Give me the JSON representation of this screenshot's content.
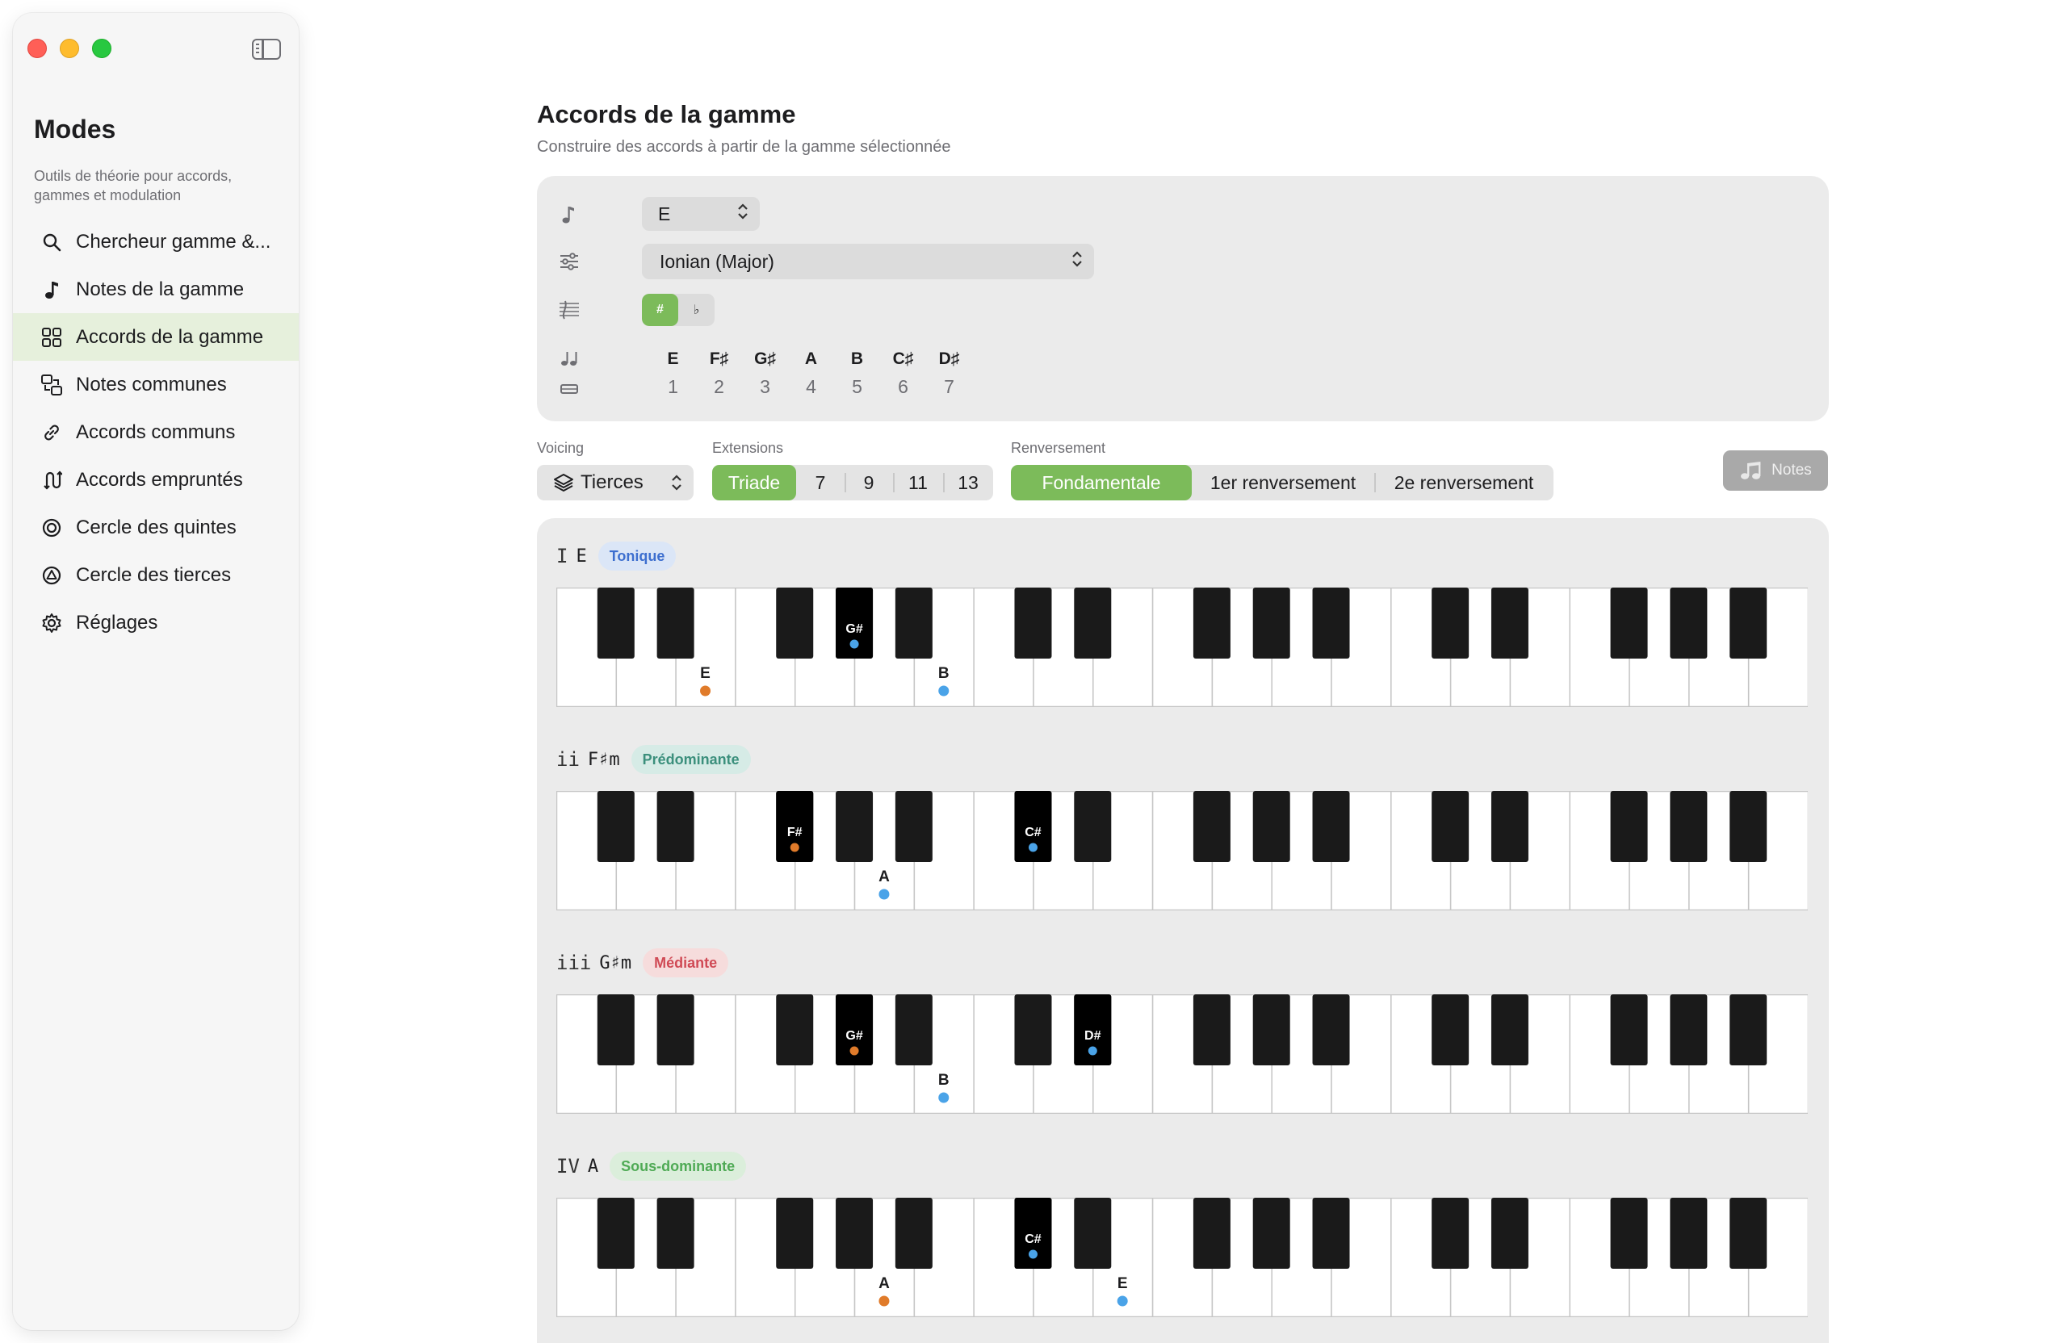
{
  "sidebar": {
    "title": "Modes",
    "description": "Outils de théorie pour accords, gammes et modulation",
    "items": [
      {
        "label": "Chercheur gamme &...",
        "icon": "search-icon",
        "active": false
      },
      {
        "label": "Notes de la gamme",
        "icon": "music-note-icon",
        "active": false
      },
      {
        "label": "Accords de la gamme",
        "icon": "grid-icon",
        "active": true
      },
      {
        "label": "Notes communes",
        "icon": "shared-notes-icon",
        "active": false
      },
      {
        "label": "Accords communs",
        "icon": "link-icon",
        "active": false
      },
      {
        "label": "Accords empruntés",
        "icon": "borrow-icon",
        "active": false
      },
      {
        "label": "Cercle des quintes",
        "icon": "circle-icon",
        "active": false
      },
      {
        "label": "Cercle des tierces",
        "icon": "triangle-circle-icon",
        "active": false
      },
      {
        "label": "Réglages",
        "icon": "gear-icon",
        "active": false
      }
    ]
  },
  "main": {
    "title": "Accords de la gamme",
    "subtitle": "Construire des accords à partir de la gamme sélectionnée"
  },
  "scale": {
    "root": "E",
    "mode": "Ionian (Major)",
    "sharp_label": "#",
    "flat_label": "♭",
    "notes": [
      "E",
      "F♯",
      "G♯",
      "A",
      "B",
      "C♯",
      "D♯"
    ],
    "degrees": [
      "1",
      "2",
      "3",
      "4",
      "5",
      "6",
      "7"
    ]
  },
  "controls": {
    "voicing_label": "Voicing",
    "voicing_value": "Tierces",
    "extensions_label": "Extensions",
    "extensions": [
      "Triade",
      "7",
      "9",
      "11",
      "13"
    ],
    "extensions_selected": "Triade",
    "inversion_label": "Renversement",
    "inversions": [
      "Fondamentale",
      "1er renversement",
      "2e renversement"
    ],
    "inversion_selected": "Fondamentale",
    "notes_button": "Notes"
  },
  "colors": {
    "accent": "#7cbb5a",
    "root_dot": "#e07b2a",
    "tone_dot": "#4aa3e8"
  },
  "chords": [
    {
      "roman": "I",
      "name": "E",
      "function": "Tonique",
      "badge_bg": "#dbe6f7",
      "badge_fg": "#3d6fcf",
      "notes": [
        {
          "label": "E",
          "kind": "white",
          "index": 2,
          "root": true
        },
        {
          "label": "G#",
          "kind": "black",
          "index": 3,
          "root": false
        },
        {
          "label": "B",
          "kind": "white",
          "index": 6,
          "root": false
        }
      ]
    },
    {
      "roman": "ii",
      "name": "F♯m",
      "function": "Prédominante",
      "badge_bg": "#d6ebe6",
      "badge_fg": "#3b8f7c",
      "notes": [
        {
          "label": "F#",
          "kind": "black",
          "index": 2,
          "root": true
        },
        {
          "label": "A",
          "kind": "white",
          "index": 5,
          "root": false
        },
        {
          "label": "C#",
          "kind": "black",
          "index": 5,
          "root": false
        }
      ]
    },
    {
      "roman": "iii",
      "name": "G♯m",
      "function": "Médiante",
      "badge_bg": "#f6dcdc",
      "badge_fg": "#d04a55",
      "notes": [
        {
          "label": "G#",
          "kind": "black",
          "index": 3,
          "root": true
        },
        {
          "label": "B",
          "kind": "white",
          "index": 6,
          "root": false
        },
        {
          "label": "D#",
          "kind": "black",
          "index": 6,
          "root": false
        }
      ]
    },
    {
      "roman": "IV",
      "name": "A",
      "function": "Sous-dominante",
      "badge_bg": "#dbeedb",
      "badge_fg": "#4faa55",
      "notes": [
        {
          "label": "A",
          "kind": "white",
          "index": 5,
          "root": true
        },
        {
          "label": "C#",
          "kind": "black",
          "index": 5,
          "root": false
        },
        {
          "label": "E",
          "kind": "white",
          "index": 9,
          "root": false
        }
      ]
    }
  ]
}
